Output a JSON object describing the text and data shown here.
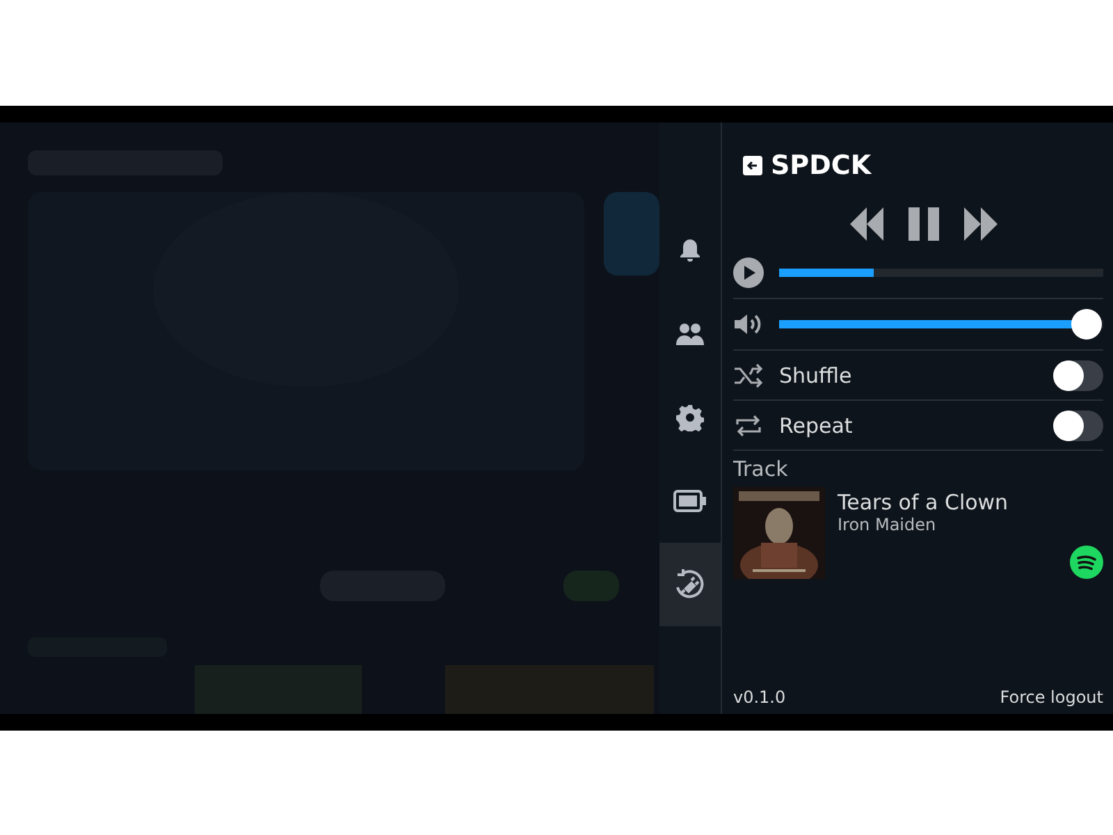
{
  "sidebar": {
    "items": [
      {
        "kind": "bell",
        "selected": false
      },
      {
        "kind": "friends",
        "selected": false
      },
      {
        "kind": "gear",
        "selected": false
      },
      {
        "kind": "battery",
        "selected": false
      },
      {
        "kind": "plug",
        "selected": true
      }
    ]
  },
  "panel": {
    "title": "SPDCK",
    "progress": {
      "level": 0.29
    },
    "volume": {
      "level": 0.95
    },
    "toggles": [
      {
        "kind": "shuffle",
        "label": "Shuffle",
        "on": false
      },
      {
        "kind": "repeat",
        "label": "Repeat",
        "on": false
      }
    ],
    "section_label": "Track",
    "track": {
      "title": "Tears of a Clown",
      "artist": "Iron Maiden"
    },
    "version": "v0.1.0",
    "logout": "Force logout"
  }
}
